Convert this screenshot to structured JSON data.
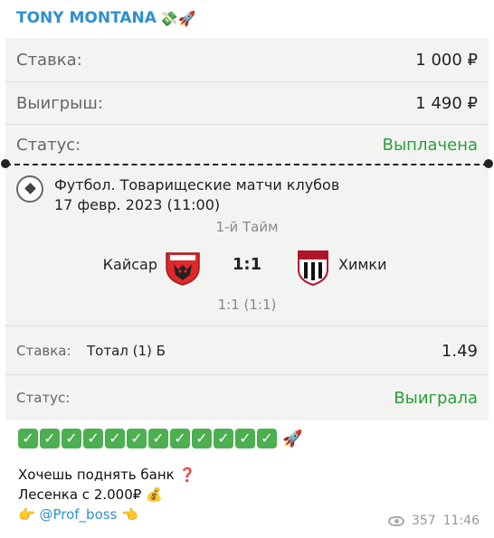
{
  "author": {
    "name": "TONY MONTANA",
    "emoji": "💸🚀"
  },
  "ticket": {
    "stake_label": "Ставка:",
    "stake_value": "1 000 ₽",
    "win_label": "Выигрыш:",
    "win_value": "1 490 ₽",
    "status_label": "Статус:",
    "status_value": "Выплачена"
  },
  "match": {
    "title_line1": "Футбол. Товарищеские матчи клубов",
    "title_line2": "17 февр. 2023 (11:00)",
    "period": "1-й Тайм",
    "team1": "Кайсар",
    "team2": "Химки",
    "score": "1:1",
    "sub_score": "1:1 (1:1)"
  },
  "bet": {
    "label": "Ставка:",
    "selection": "Тотал (1) Б",
    "odds": "1.49",
    "status_label": "Статус:",
    "status_value": "Выиграла"
  },
  "message": {
    "checks": [
      "✓",
      "✓",
      "✓",
      "✓",
      "✓",
      "✓",
      "✓",
      "✓",
      "✓",
      "✓",
      "✓",
      "✓"
    ],
    "rocket": "🚀",
    "line1": "Хочешь поднять банк",
    "line1_emoji": "❓",
    "line2": "Лесенка с 2.000₽",
    "line2_emoji": "💰",
    "line3_left": "👉",
    "handle": "@Prof_boss",
    "line3_right": "👈"
  },
  "meta": {
    "views": "357",
    "time": "11:46"
  },
  "colors": {
    "accent": "#2f8fd0",
    "success": "#2a9d3a"
  }
}
